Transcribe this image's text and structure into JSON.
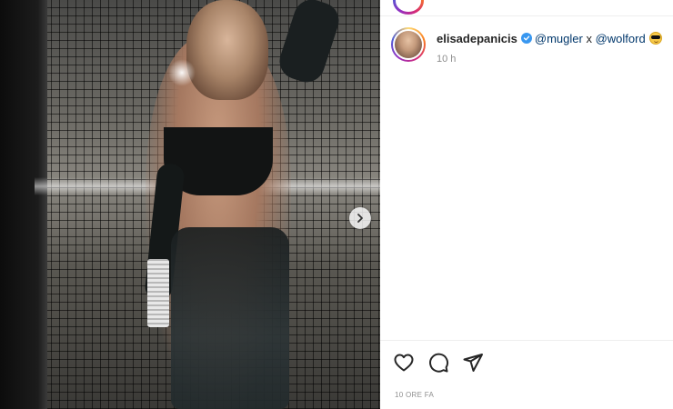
{
  "post": {
    "username": "elisadepanicis",
    "verified": true,
    "caption_mentions": [
      "@mugler",
      "x",
      "@wolford"
    ],
    "caption_emoji": "smiling-face-with-sunglasses",
    "time_ago": "10 h",
    "posted_label": "10 ORE FA"
  },
  "icons": {
    "like": "heart-icon",
    "comment": "comment-bubble-icon",
    "share": "paper-plane-icon",
    "next": "chevron-right-icon",
    "verified": "verified-badge-icon"
  },
  "colors": {
    "text": "#262626",
    "muted": "#8e8e8e",
    "mention": "#00376b",
    "verified": "#3897f0",
    "divider": "#efefef"
  }
}
